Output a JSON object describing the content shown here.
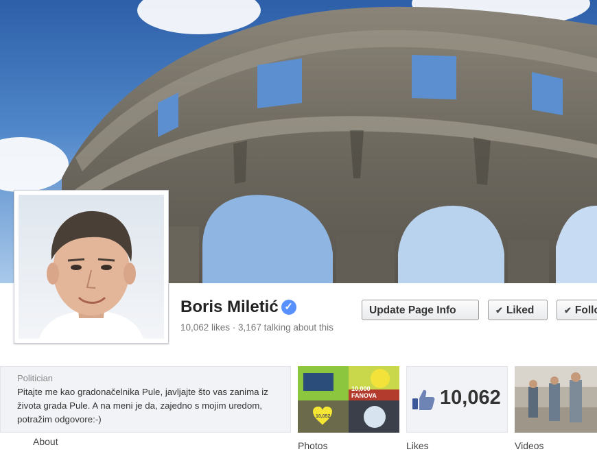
{
  "page": {
    "name": "Boris Miletić",
    "stats": "10,062 likes · 3,167 talking about this"
  },
  "buttons": {
    "update_info": "Update Page Info",
    "liked": "Liked",
    "follow": "Follow"
  },
  "about": {
    "category": "Politician",
    "description": "Pitajte me kao gradonačelnika Pule, javljajte što vas zanima iz života grada Pule. A na meni je da, zajedno s mojim uredom, potražim odgovore:-)",
    "label": "About"
  },
  "tiles": {
    "photos_label": "Photos",
    "likes_label": "Likes",
    "likes_count": "10,062",
    "videos_label": "Videos",
    "photo_texts": [
      "10,000 FANOVA",
      "10,052"
    ]
  },
  "colors": {
    "accent": "#3b5998",
    "verified": "#5890ff",
    "about_bg": "#f2f3f6"
  },
  "icons": [
    "verified-badge-icon",
    "check-icon",
    "thumbs-up-icon"
  ]
}
